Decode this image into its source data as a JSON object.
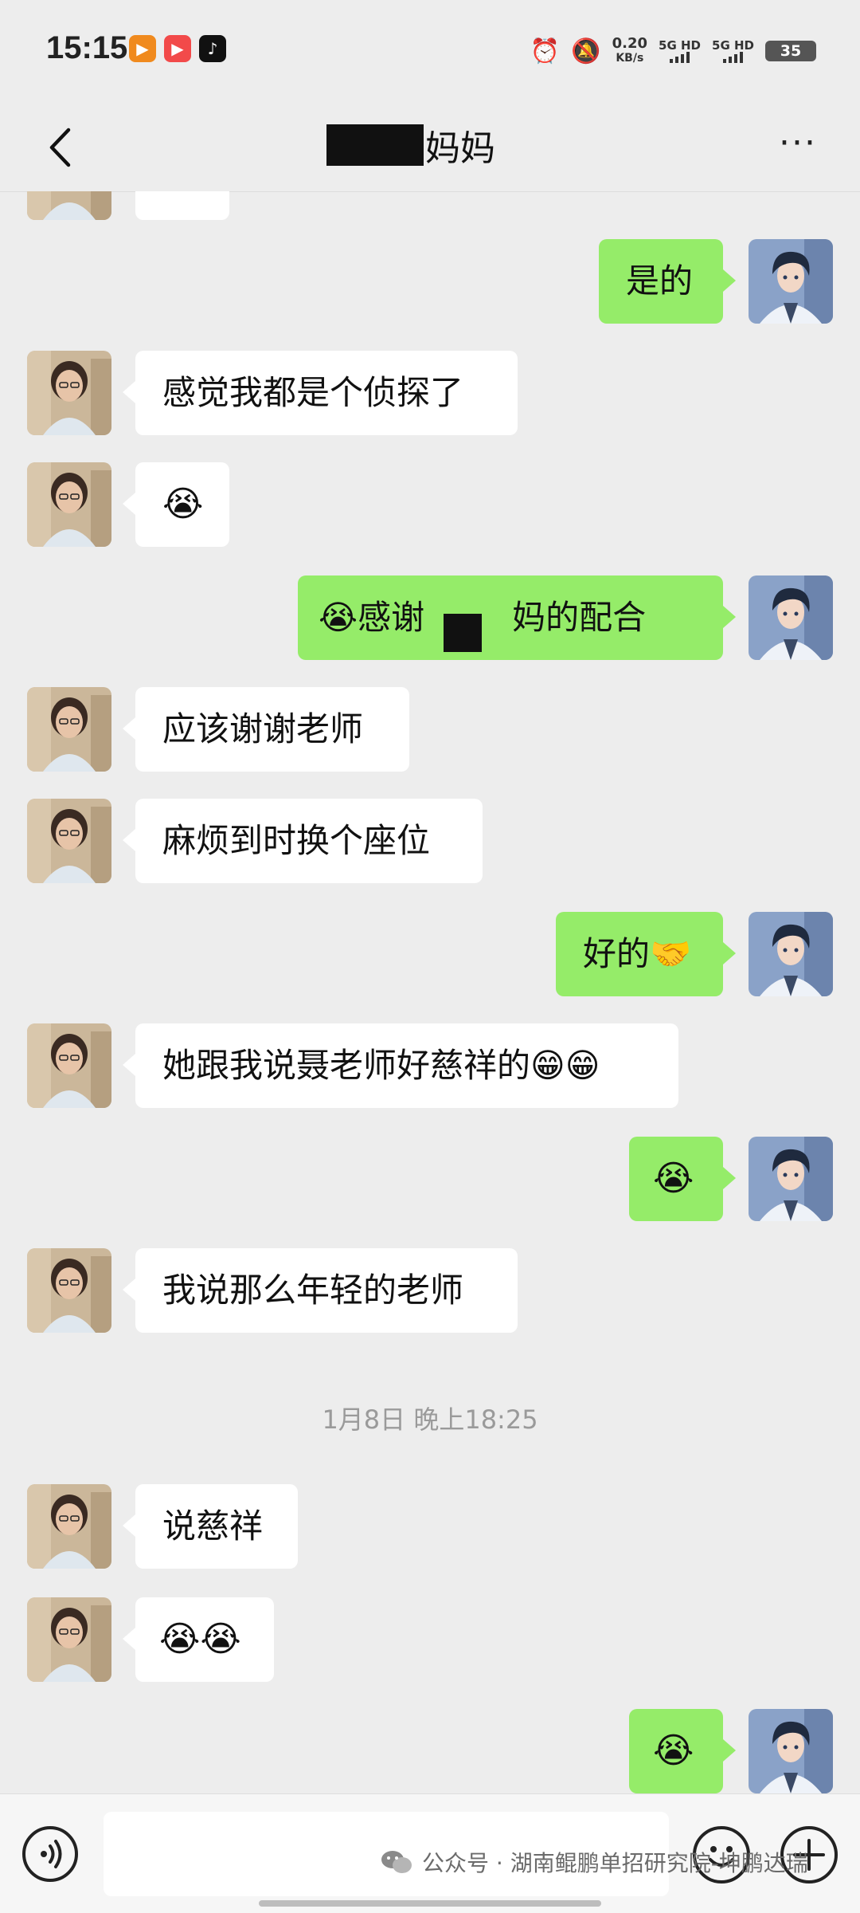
{
  "status_bar": {
    "time": "15:15",
    "net_speed_value": "0.20",
    "net_speed_unit": "KB/s",
    "sim1": "5G HD",
    "sim2": "5G HD",
    "battery": "35"
  },
  "header": {
    "title_suffix": "妈妈"
  },
  "messages": [
    {
      "dir": "out",
      "text": "是的"
    },
    {
      "dir": "in",
      "text": "感觉我都是个侦探了"
    },
    {
      "dir": "in",
      "text": "😭"
    },
    {
      "dir": "out",
      "text_prefix": "😭感谢",
      "text_suffix": "妈的配合"
    },
    {
      "dir": "in",
      "text": "应该谢谢老师"
    },
    {
      "dir": "in",
      "text": "麻烦到时换个座位"
    },
    {
      "dir": "out",
      "text": "好的🤝"
    },
    {
      "dir": "in",
      "text": "她跟我说聂老师好慈祥的😁😁"
    },
    {
      "dir": "out",
      "text": "😭"
    },
    {
      "dir": "in",
      "text": "我说那么年轻的老师"
    },
    {
      "dir": "in",
      "text": "说慈祥"
    },
    {
      "dir": "in",
      "text": "😭😭"
    },
    {
      "dir": "out",
      "text": "😭"
    }
  ],
  "timestamp": "1月8日 晚上18:25",
  "watermark": {
    "text": "公众号 · 湖南鲲鹏单招研究院-坤鹏达瑞"
  },
  "colors": {
    "background": "#ededed",
    "incoming_bubble": "#ffffff",
    "outgoing_bubble": "#95ec69"
  }
}
